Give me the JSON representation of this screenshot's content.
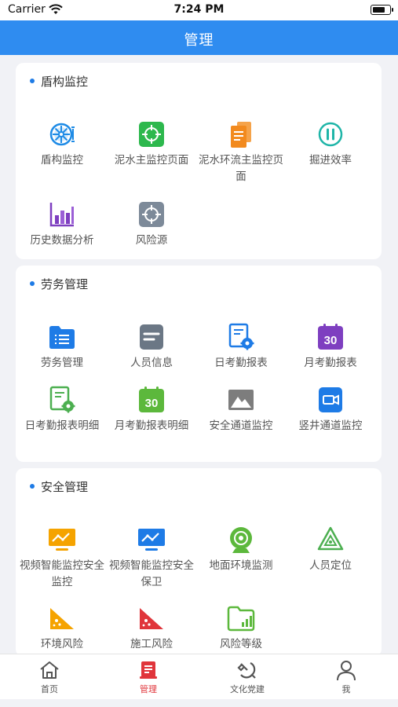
{
  "status_bar": {
    "carrier": "Carrier",
    "time": "7:24 PM"
  },
  "nav": {
    "title": "管理"
  },
  "sections": [
    {
      "title": "盾构监控",
      "items": [
        {
          "label": "盾构监控",
          "icon": "shield-machine-icon",
          "color": "#1e8be6"
        },
        {
          "label": "泥水主监控页面",
          "icon": "crosshair-icon",
          "color": "#2db84d"
        },
        {
          "label": "泥水环流主监控页面",
          "icon": "report-stack-icon",
          "color": "#f28a1e"
        },
        {
          "label": "掘进效率",
          "icon": "pause-circle-icon",
          "color": "#1fb5a8"
        },
        {
          "label": "历史数据分析",
          "icon": "bar-chart-icon",
          "color": "#7e3fc0"
        },
        {
          "label": "风险源",
          "icon": "crosshair-icon",
          "color": "#7d8a99"
        }
      ]
    },
    {
      "title": "劳务管理",
      "items": [
        {
          "label": "劳务管理",
          "icon": "folder-list-icon",
          "color": "#1e7be6"
        },
        {
          "label": "人员信息",
          "icon": "info-card-icon",
          "color": "#6b7785"
        },
        {
          "label": "日考勤报表",
          "icon": "attendance-gear-icon",
          "color": "#1e7be6"
        },
        {
          "label": "月考勤报表",
          "icon": "calendar-30-icon",
          "color": "#7e3fc0",
          "badge": "30"
        },
        {
          "label": "日考勤报表明细",
          "icon": "attendance-gear-icon",
          "color": "#4caf50"
        },
        {
          "label": "月考勤报表明细",
          "icon": "calendar-30-icon",
          "color": "#5cb83c",
          "badge": "30"
        },
        {
          "label": "安全通道监控",
          "icon": "mountain-image-icon",
          "color": "#7d7d7d"
        },
        {
          "label": "竖井通道监控",
          "icon": "video-camera-icon",
          "color": "#1e7be6"
        }
      ]
    },
    {
      "title": "安全管理",
      "items": [
        {
          "label": "视频智能监控安全监控",
          "icon": "monitor-chart-icon",
          "color": "#f5a300"
        },
        {
          "label": "视频智能监控安全保卫",
          "icon": "monitor-chart-icon",
          "color": "#1e7be6"
        },
        {
          "label": "地面环境监测",
          "icon": "environment-sensor-icon",
          "color": "#5cb83c"
        },
        {
          "label": "人员定位",
          "icon": "recycle-triangle-icon",
          "color": "#4caf50"
        },
        {
          "label": "环境风险",
          "icon": "slope-icon",
          "color": "#f5a300"
        },
        {
          "label": "施工风险",
          "icon": "slope-icon",
          "color": "#e0353b"
        },
        {
          "label": "风险等级",
          "icon": "folder-bars-icon",
          "color": "#5cb83c"
        }
      ]
    }
  ],
  "tabs": [
    {
      "label": "首页",
      "icon": "home-icon",
      "active": false
    },
    {
      "label": "管理",
      "icon": "manage-icon",
      "active": true
    },
    {
      "label": "文化党建",
      "icon": "party-emblem-icon",
      "active": false
    },
    {
      "label": "我",
      "icon": "user-icon",
      "active": false
    }
  ],
  "colors": {
    "primary": "#2f8cf0",
    "active_tab": "#e0353b"
  }
}
